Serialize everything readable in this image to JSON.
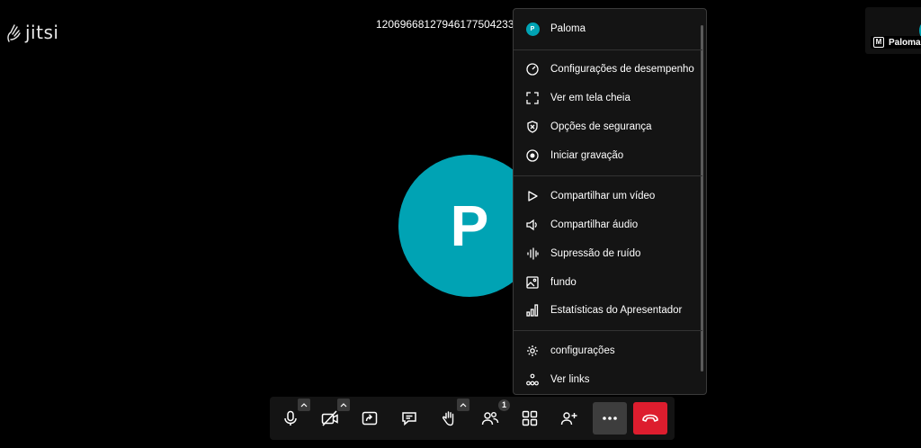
{
  "app": {
    "logo_text": "jitsi"
  },
  "room": {
    "name": "1206966812794617750423332"
  },
  "participant": {
    "name": "Paloma",
    "initial": "P",
    "avatar_color": "#00a3b4",
    "moderator_badge": "M"
  },
  "menu": {
    "user": {
      "name": "Paloma",
      "initial": "P"
    },
    "items": [
      {
        "label": "Configurações de desempenho",
        "icon": "gauge-icon"
      },
      {
        "label": "Ver em tela cheia",
        "icon": "fullscreen-icon"
      },
      {
        "label": "Opções de segurança",
        "icon": "shield-icon"
      },
      {
        "label": "Iniciar gravação",
        "icon": "record-icon"
      },
      {
        "label": "Compartilhar um vídeo",
        "icon": "play-icon"
      },
      {
        "label": "Compartilhar áudio",
        "icon": "speaker-icon"
      },
      {
        "label": "Supressão de ruído",
        "icon": "waveform-icon"
      },
      {
        "label": "fundo",
        "icon": "image-icon"
      },
      {
        "label": "Estatísticas do Apresentador",
        "icon": "bar-chart-icon"
      },
      {
        "label": "configurações",
        "icon": "gear-icon"
      },
      {
        "label": "Ver links",
        "icon": "links-icon"
      }
    ]
  },
  "toolbar": {
    "participants_count": "1",
    "colors": {
      "hangup": "#dd1d2e",
      "active": "#3d3d3d"
    }
  }
}
